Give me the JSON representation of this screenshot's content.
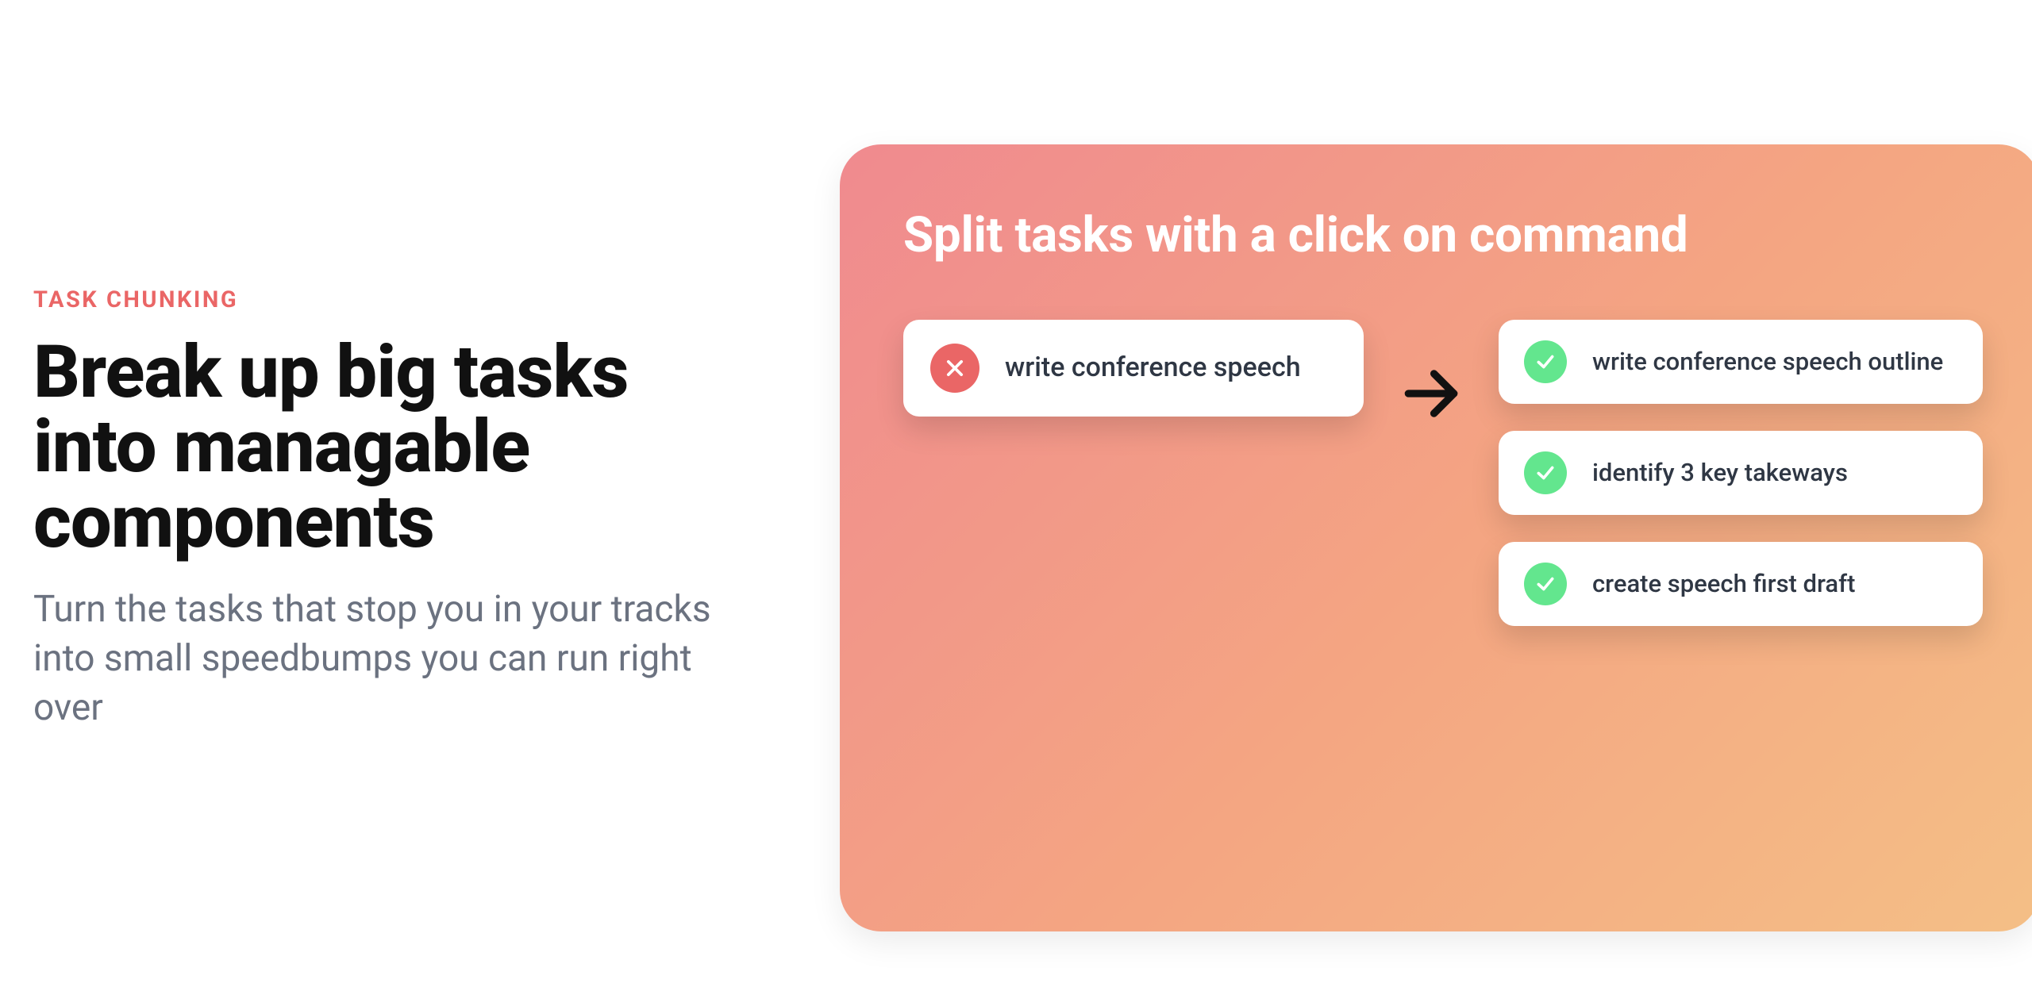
{
  "left": {
    "eyebrow": "TASK CHUNKING",
    "heading": "Break up big tasks into managable components",
    "subheading": "Turn the tasks that stop you in your tracks into small speedbumps you can run right over"
  },
  "panel": {
    "title": "Split tasks with a click on command",
    "source_task": {
      "label": "write conference speech",
      "icon": "x-icon",
      "status": "incomplete"
    },
    "dest_tasks": [
      {
        "label": "write conference speech outline",
        "icon": "check-icon",
        "status": "complete"
      },
      {
        "label": "identify 3 key takeways",
        "icon": "check-icon",
        "status": "complete"
      },
      {
        "label": "create speech first draft",
        "icon": "check-icon",
        "status": "complete"
      }
    ]
  },
  "colors": {
    "accent_red": "#ea6666",
    "accent_green": "#63e68e",
    "panel_gradient_start": "#f08a8f",
    "panel_gradient_end": "#f4bf86"
  }
}
